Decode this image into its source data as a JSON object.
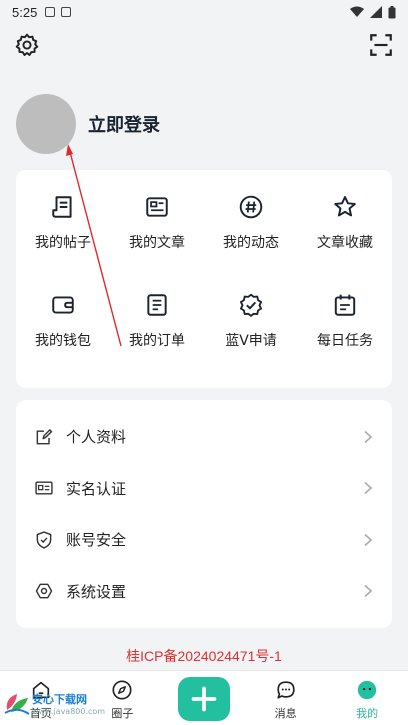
{
  "status_bar": {
    "time": "5:25"
  },
  "header": {
    "settings_icon": "gear-icon",
    "scan_icon": "scan-icon"
  },
  "profile": {
    "login_label": "立即登录"
  },
  "shortcuts": [
    {
      "label": "我的帖子",
      "icon": "post-icon"
    },
    {
      "label": "我的文章",
      "icon": "article-icon"
    },
    {
      "label": "我的动态",
      "icon": "hashtag-icon"
    },
    {
      "label": "文章收藏",
      "icon": "star-icon"
    },
    {
      "label": "我的钱包",
      "icon": "wallet-icon"
    },
    {
      "label": "我的订单",
      "icon": "order-icon"
    },
    {
      "label": "蓝V申请",
      "icon": "verified-badge-icon"
    },
    {
      "label": "每日任务",
      "icon": "calendar-icon"
    }
  ],
  "settings_list": [
    {
      "label": "个人资料",
      "icon": "edit-profile-icon"
    },
    {
      "label": "实名认证",
      "icon": "id-card-icon"
    },
    {
      "label": "账号安全",
      "icon": "shield-icon"
    },
    {
      "label": "系统设置",
      "icon": "hexagon-settings-icon"
    }
  ],
  "icp": "桂ICP备2024024471号-1",
  "tabbar": {
    "items": [
      {
        "label": "首页",
        "icon": "home-icon"
      },
      {
        "label": "圈子",
        "icon": "compass-icon"
      },
      {
        "label": "",
        "icon": "add-icon"
      },
      {
        "label": "消息",
        "icon": "message-icon"
      },
      {
        "label": "我的",
        "icon": "smile-icon"
      }
    ],
    "active_index": 4
  },
  "watermark": {
    "line1": "安心下载网",
    "line2": "www.java800.com"
  },
  "colors": {
    "accent": "#22c09f",
    "icp_red": "#e03030",
    "annotation_red": "#e0282e"
  }
}
